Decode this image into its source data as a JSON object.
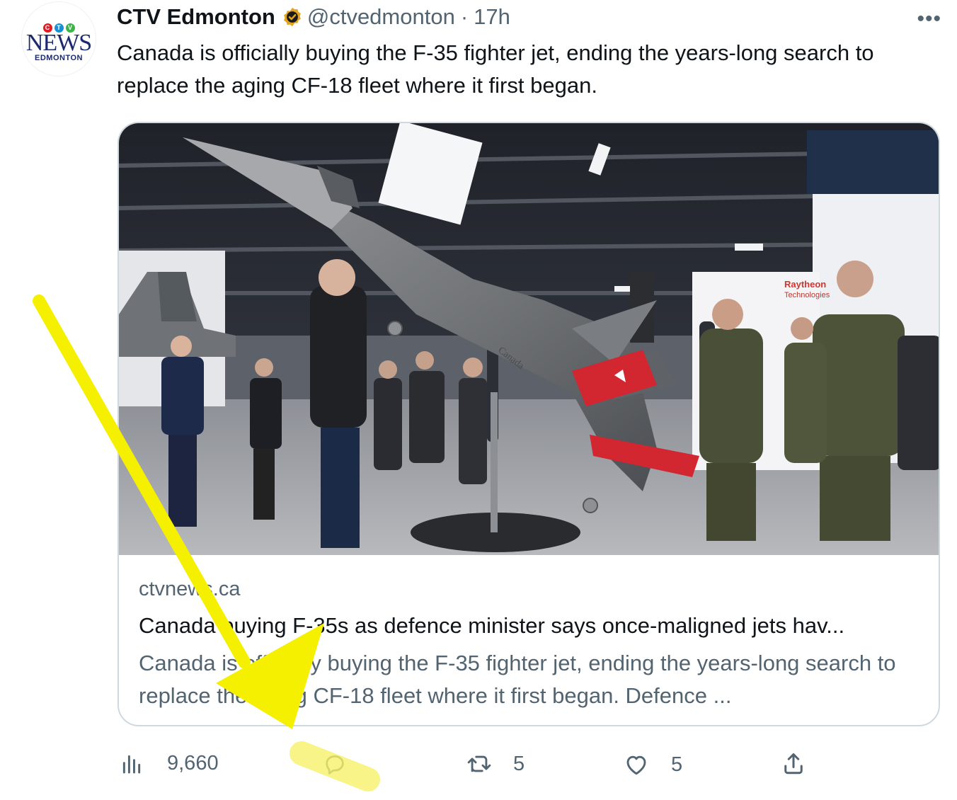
{
  "author": {
    "name": "CTV Edmonton",
    "handle": "@ctvedmonton",
    "separator": "·",
    "time": "17h",
    "avatar": {
      "brand": "NEWS",
      "city": "EDMONTON",
      "logo_letters": [
        "C",
        "T",
        "V"
      ],
      "logo_colors": [
        "#e21b22",
        "#1a8fd3",
        "#3bb44a"
      ]
    },
    "verified_color": "#e2a521"
  },
  "more_label": "•••",
  "tweet_text": "Canada is officially buying the F-35 fighter jet, ending the years-long search to replace the aging CF-18 fleet where it first began.",
  "card": {
    "photo_signs": {
      "brand": "Raytheon",
      "sub": "Technologies",
      "jet_label": "Canada"
    },
    "domain": "ctvnews.ca",
    "title": "Canada buying F-35s as defence minister says once-maligned jets hav...",
    "description": "Canada is officially buying the F-35 fighter jet, ending the years-long search to replace the aging CF-18 fleet where it first began. Defence ..."
  },
  "actions": {
    "views": {
      "icon": "analytics-icon",
      "count": "9,660"
    },
    "reply": {
      "icon": "reply-icon",
      "count": ""
    },
    "retweet": {
      "icon": "retweet-icon",
      "count": "5"
    },
    "like": {
      "icon": "heart-icon",
      "count": "5"
    },
    "share": {
      "icon": "share-icon"
    }
  },
  "annotation": {
    "arrow_color": "#f5f000",
    "highlight_color": "#f7f26a"
  },
  "colors": {
    "text": "#0f1419",
    "secondary": "#536471",
    "border": "#cfd9de"
  }
}
